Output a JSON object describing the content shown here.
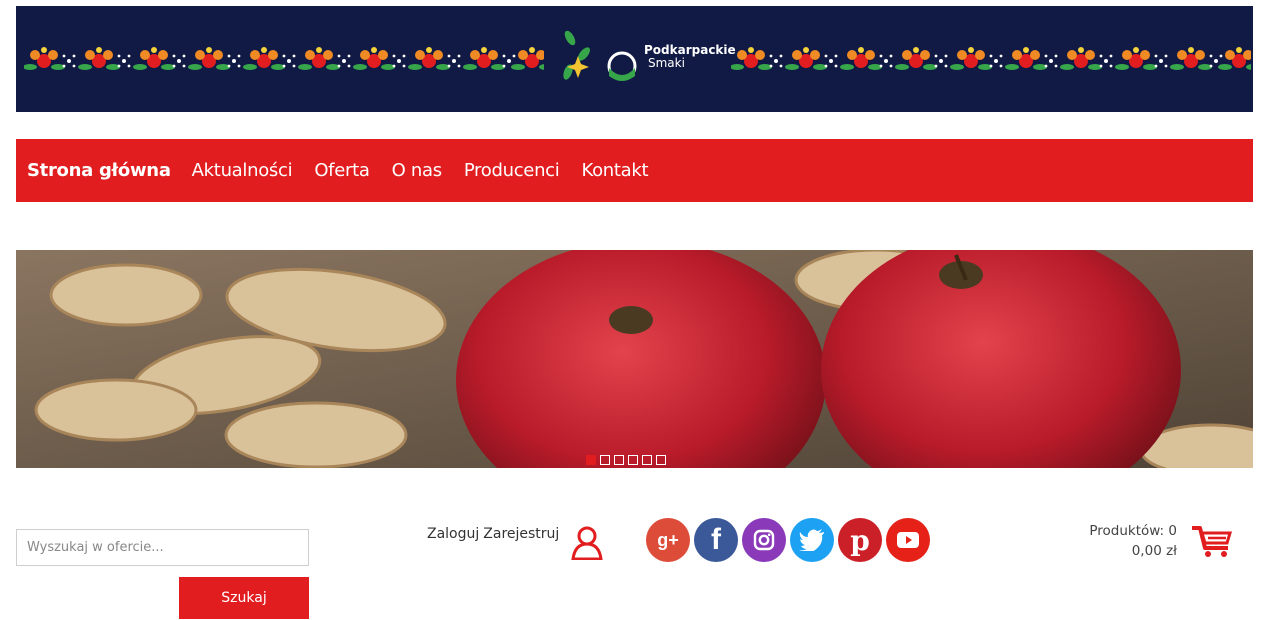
{
  "header": {
    "logo": {
      "line1": "Podkarpackie",
      "line2": "Smaki"
    }
  },
  "nav": {
    "items": [
      {
        "label": "Strona główna",
        "active": true
      },
      {
        "label": "Aktualności"
      },
      {
        "label": "Oferta"
      },
      {
        "label": "O nas"
      },
      {
        "label": "Producenci"
      },
      {
        "label": "Kontakt"
      }
    ]
  },
  "hero": {
    "slides_total": 6,
    "active_slide": 1
  },
  "search": {
    "placeholder": "Wyszukaj w ofercie...",
    "button_label": "Szukaj"
  },
  "account": {
    "login_label": "Zaloguj",
    "register_label": "Zarejestruj",
    "icon": "user-icon"
  },
  "social": [
    {
      "name": "google-plus-icon",
      "color": "#dd4b39"
    },
    {
      "name": "facebook-icon",
      "color": "#3b5998"
    },
    {
      "name": "instagram-icon",
      "color": "#8a3ab9"
    },
    {
      "name": "twitter-icon",
      "color": "#1da1f2"
    },
    {
      "name": "pinterest-icon",
      "color": "#cb2027"
    },
    {
      "name": "youtube-icon",
      "color": "#e62117"
    }
  ],
  "cart": {
    "products_label": "Produktów: 0",
    "total": "0,00 zł",
    "icon": "cart-icon"
  },
  "colors": {
    "brand_red": "#e11d1f",
    "banner_navy": "#111a45"
  }
}
